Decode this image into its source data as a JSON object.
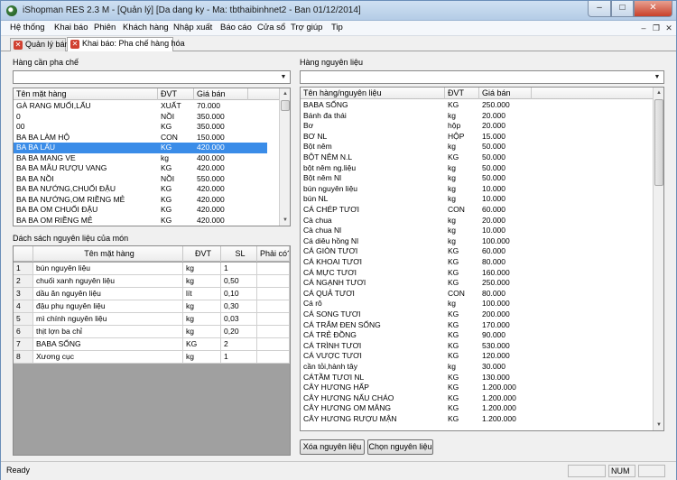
{
  "window": {
    "title": "iShopman RES 2.3 M - [Quản lý] [Da dang ky - Ma: tbthaibinhnet2 - Ban 01/12/2014]",
    "min": "–",
    "max": "□",
    "close": "✕"
  },
  "menu": [
    "Hệ thống",
    "Khai báo",
    "Phiên",
    "Khách hàng",
    "Nhập xuất",
    "Báo cáo",
    "Cửa sổ",
    "Trợ giúp",
    "Tip"
  ],
  "mdi": {
    "min": "–",
    "restore": "❐",
    "close": "✕"
  },
  "tabs": [
    {
      "label": "Quản lý bán"
    },
    {
      "label": "Khai báo: Pha chế hàng hóa"
    }
  ],
  "left": {
    "section_label": "Hàng cần pha chế",
    "products_grid": {
      "headers": [
        "Tên mặt hàng",
        "ĐVT",
        "Giá bán"
      ],
      "rows": [
        [
          "GÀ RANG MUỐI,LẨU",
          "XUẤT",
          "70.000"
        ],
        [
          "0",
          "NỒI",
          "350.000"
        ],
        [
          "00",
          "KG",
          "350.000"
        ],
        [
          "BA BA LÀM HỘ",
          "CON",
          "150.000"
        ],
        [
          "BA BA LẨU",
          "KG",
          "420.000"
        ],
        [
          "BA BA MANG VE",
          "kg",
          "400.000"
        ],
        [
          "BA BA MẪU RƯỢU VANG",
          "KG",
          "420.000"
        ],
        [
          "BA BA NỒI",
          "NỒI",
          "550.000"
        ],
        [
          "BA BA NƯỚNG,CHUỐI ĐẬU",
          "KG",
          "420.000"
        ],
        [
          "BA BA NƯỚNG,OM RIỀNG MẺ",
          "KG",
          "420.000"
        ],
        [
          "BA BA OM CHUỐI ĐẬU",
          "KG",
          "420.000"
        ],
        [
          "BA BA OM RIỀNG MẺ",
          "KG",
          "420.000"
        ]
      ],
      "selected_index": 4
    },
    "ingredients_label": "Dách sách nguyên liệu của món",
    "ingredients_grid": {
      "headers": [
        "",
        "Tên mặt hàng",
        "ĐVT",
        "SL",
        "Phải có?"
      ],
      "rows": [
        [
          "1",
          "bún nguyên liệu",
          "kg",
          "1"
        ],
        [
          "2",
          "chuối xanh nguyên liệu",
          "kg",
          "0,50"
        ],
        [
          "3",
          "dầu ăn nguyên liệu",
          "lít",
          "0,10"
        ],
        [
          "4",
          "đậu phụ nguyên liệu",
          "kg",
          "0,30"
        ],
        [
          "5",
          "mì chính nguyên liệu",
          "kg",
          "0,03"
        ],
        [
          "6",
          "thịt lợn ba chỉ",
          "kg",
          "0,20"
        ],
        [
          "7",
          "BABA SỐNG",
          "KG",
          "2"
        ],
        [
          "8",
          "Xương cục",
          "kg",
          "1"
        ]
      ]
    }
  },
  "right": {
    "section_label": "Hàng nguyên liệu",
    "materials_grid": {
      "headers": [
        "Tên hàng/nguyên liệu",
        "ĐVT",
        "Giá bán"
      ],
      "rows": [
        [
          "BABA SỐNG",
          "KG",
          "250.000"
        ],
        [
          "Bánh đa thái",
          "kg",
          "20.000"
        ],
        [
          "Bơ",
          "hộp",
          "20.000"
        ],
        [
          "BƠ NL",
          "HỘP",
          "15.000"
        ],
        [
          "Bột nêm",
          "kg",
          "50.000"
        ],
        [
          "BỘT NÊM N.L",
          "KG",
          "50.000"
        ],
        [
          "bột nêm ng.liệu",
          "kg",
          "50.000"
        ],
        [
          "Bột nêm Nl",
          "kg",
          "50.000"
        ],
        [
          "bún nguyên liệu",
          "kg",
          "10.000"
        ],
        [
          "bún NL",
          "kg",
          "10.000"
        ],
        [
          "CÁ CHÉP TƯƠI",
          "CON",
          "60.000"
        ],
        [
          "Cà chua",
          "kg",
          "20.000"
        ],
        [
          "Cà chua Nl",
          "kg",
          "10.000"
        ],
        [
          "Cá diêu hồng Nl",
          "kg",
          "100.000"
        ],
        [
          "CÁ GIÒN TƯƠI",
          "KG",
          "60.000"
        ],
        [
          "CÁ KHOAI TƯƠI",
          "KG",
          "80.000"
        ],
        [
          "CÁ MỰC TƯƠI",
          "KG",
          "160.000"
        ],
        [
          "CÁ NGẠNH TƯƠI",
          "KG",
          "250.000"
        ],
        [
          "CÁ QUẢ TƯƠI",
          "CON",
          "80.000"
        ],
        [
          "Cá rô",
          "kg",
          "100.000"
        ],
        [
          "CÁ SONG TƯƠI",
          "KG",
          "200.000"
        ],
        [
          "CÁ TRẮM ĐEN SỐNG",
          "KG",
          "170.000"
        ],
        [
          "CÁ TRẺ ĐỒNG",
          "KG",
          "90.000"
        ],
        [
          "CÁ TRÌNH TƯƠI",
          "KG",
          "530.000"
        ],
        [
          "CÁ VƯỢC TƯƠI",
          "KG",
          "120.000"
        ],
        [
          "cần tỏi,hành tây",
          "kg",
          "30.000"
        ],
        [
          "CÁTẦM TƯƠI NL",
          "KG",
          "130.000"
        ],
        [
          "CÂY HƯƠNG HẤP",
          "KG",
          "1.200.000"
        ],
        [
          "CÂY HƯƠNG NẤU CHÁO",
          "KG",
          "1.200.000"
        ],
        [
          "CÂY HƯƠNG OM MĂNG",
          "KG",
          "1.200.000"
        ],
        [
          "CÂY HƯƠNG RƯỢU MẬN",
          "KG",
          "1.200.000"
        ]
      ]
    },
    "buttons": {
      "remove": "Xóa nguyên liệu",
      "choose": "Chọn nguyên liệu"
    }
  },
  "status": {
    "text": "Ready",
    "num": "NUM"
  }
}
